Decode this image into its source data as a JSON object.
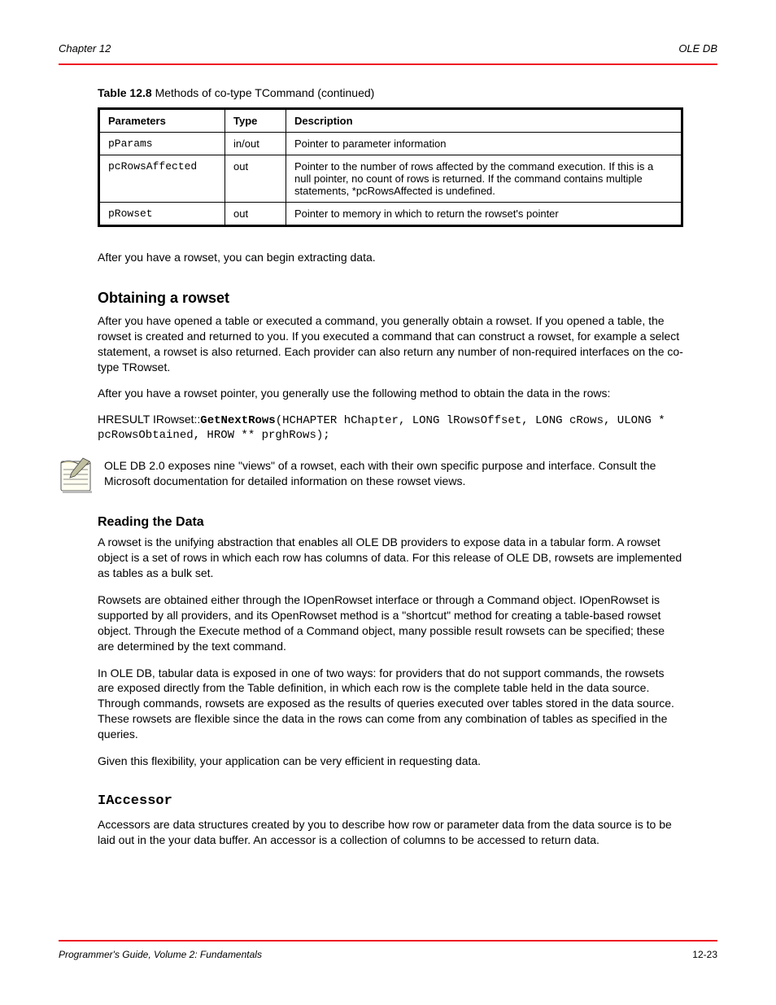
{
  "header": {
    "left": "Chapter 12",
    "right": "OLE DB"
  },
  "footer": {
    "left": "Programmer's Guide, Volume 2: Fundamentals",
    "right": "12-23"
  },
  "table": {
    "caption_prefix": "Table 12.8",
    "caption": "Methods of co-type TCommand (continued)",
    "columns": [
      "Parameters",
      "Type",
      "Description"
    ],
    "rows": [
      {
        "param": "pParams",
        "type": "in/out",
        "desc": "Pointer to parameter information"
      },
      {
        "param": "pcRowsAffected",
        "type": "out",
        "desc": "Pointer to the number of rows affected by the command execution. If this is a null pointer, no count of rows is returned. If the command contains multiple statements, *pcRowsAffected is undefined."
      },
      {
        "param": "pRowset",
        "type": "out",
        "desc": "Pointer to memory in which to return the rowset's pointer"
      }
    ]
  },
  "paragraph_post_table": "After you have a rowset, you can begin extracting data.",
  "section_rowset": {
    "title": "Obtaining a rowset",
    "p1": "After you have opened a table or executed a command, you generally obtain a rowset. If you opened a table, the rowset is created and returned to you. If you executed a command that can construct a rowset, for example a select statement, a rowset is also returned. Each provider can also return any number of non-required interfaces on the co-type TRowset.",
    "p2": "After you have a rowset pointer, you generally use the following method to obtain the data in the rows:",
    "method_label": "HRESULT IRowset::",
    "method_name1": "GetNextRows",
    "method_sig1_args": "(HCHAPTER hChapter, LONG lRowsOffset, LONG cRows, ULONG * pcRowsObtained, HROW ** prghRows);",
    "note": "OLE DB 2.0 exposes nine \"views\" of a rowset, each with their own specific purpose and interface. Consult the Microsoft documentation for detailed information on these rowset views.",
    "sub_title": "Reading the Data",
    "p3": "A rowset is the unifying abstraction that enables all OLE DB providers to expose data in a tabular form. A rowset object is a set of rows in which each row has columns of data. For this release of OLE DB, rowsets are implemented as tables as a bulk set.",
    "p4": "Rowsets are obtained either through the IOpenRowset interface or through a Command object. IOpenRowset is supported by all providers, and its OpenRowset method is a \"shortcut\" method for creating a table-based rowset object. Through the Execute method of a Command object, many possible result rowsets can be specified; these are determined by the text command.",
    "p5": "In OLE DB, tabular data is exposed in one of two ways: for providers that do not support commands, the rowsets are exposed directly from the Table definition, in which each row is the complete table held in the data source. Through commands, rowsets are exposed as the results of queries executed over tables stored in the data source. These rowsets are flexible since the data in the rows can come from any combination of tables as specified in the queries.",
    "p6": "Given this flexibility, your application can be very efficient in requesting data."
  },
  "section_iaccessor": {
    "intf": "IAccessor",
    "p1": "Accessors are data structures created by you to describe how row or parameter data from the data source is to be laid out in the your data buffer. An accessor is a collection of columns to be accessed to return data."
  },
  "icon": {
    "name": "notepad-icon"
  }
}
